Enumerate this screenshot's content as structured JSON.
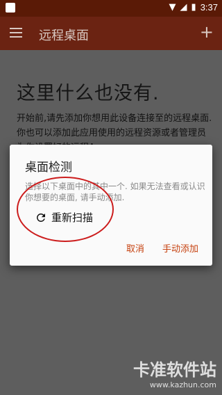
{
  "status_bar": {
    "time": "3:37",
    "icons": [
      "wifi-icon",
      "signal-icon",
      "battery-icon"
    ]
  },
  "app_bar": {
    "title": "远程桌面",
    "menu_icon": "menu-icon",
    "add_icon": "+"
  },
  "empty_state": {
    "title": "这里什么也没有.",
    "description": "开始前,请先添加你想用此设备连接至的远程桌面.你也可以添加此应用使用的远程资源或者管理员为你设置好的远程App"
  },
  "dialog": {
    "title": "桌面检测",
    "message": "选择以下桌面中的其中一个. 如果无法查看或认识你想要的桌面, 请手动添加.",
    "rescan_label": "重新扫描",
    "cancel_label": "取消",
    "manual_add_label": "手动添加"
  },
  "watermark": {
    "main": "卡准软件站",
    "url": "www.kazhun.com"
  },
  "colors": {
    "app_bar": "#6b2312",
    "status_bar": "#5a1a06",
    "accent": "#c64210",
    "highlight": "#cc1c1c"
  }
}
